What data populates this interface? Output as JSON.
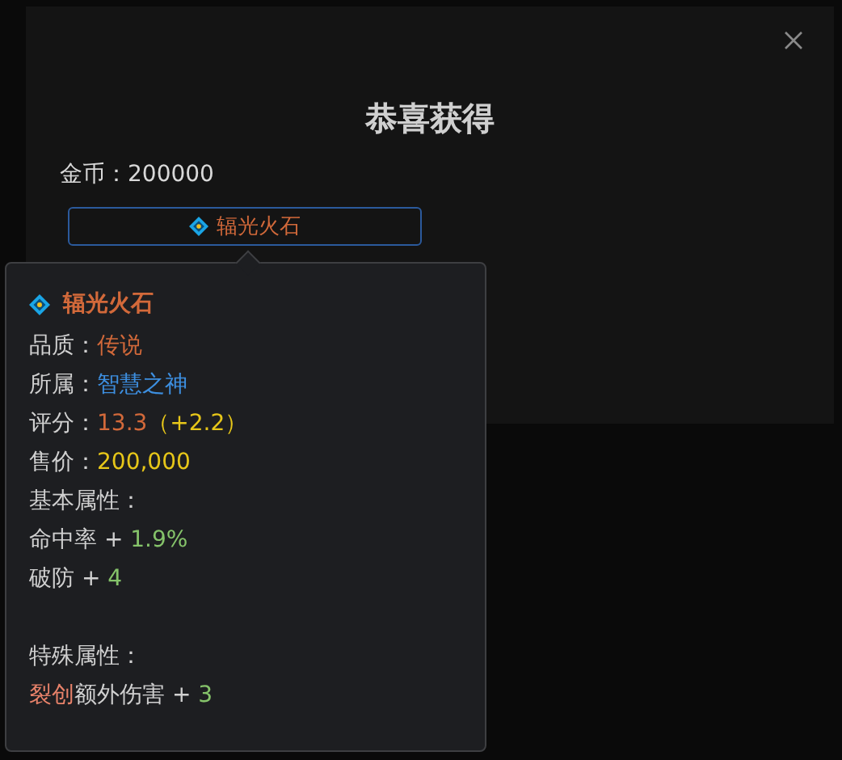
{
  "dialog": {
    "title": "恭喜获得",
    "gold_label": "金币：",
    "gold_value": "200000",
    "item_button": {
      "label": "辐光火石"
    }
  },
  "tooltip": {
    "name": "辐光火石",
    "fields": [
      {
        "label": "品质：",
        "value": "传说",
        "color": "#d2693a"
      },
      {
        "label": "所属：",
        "value": "智慧之神",
        "color": "#3d8fe0"
      },
      {
        "label": "评分：",
        "value": "13.3",
        "color": "#d2693a",
        "extra": "（+2.2）"
      },
      {
        "label": "售价：",
        "value": "200,000",
        "color": "#e6c619"
      }
    ],
    "sections": [
      {
        "title": "基本属性：",
        "stats": [
          {
            "name": "命中率",
            "sign": "+",
            "value": "1.9%"
          },
          {
            "name": "破防",
            "sign": "+",
            "value": "4"
          }
        ]
      },
      {
        "title": "特殊属性：",
        "stats": [
          {
            "prefix": "裂创",
            "name": "额外伤害",
            "sign": "+",
            "value": "3"
          }
        ]
      }
    ]
  }
}
